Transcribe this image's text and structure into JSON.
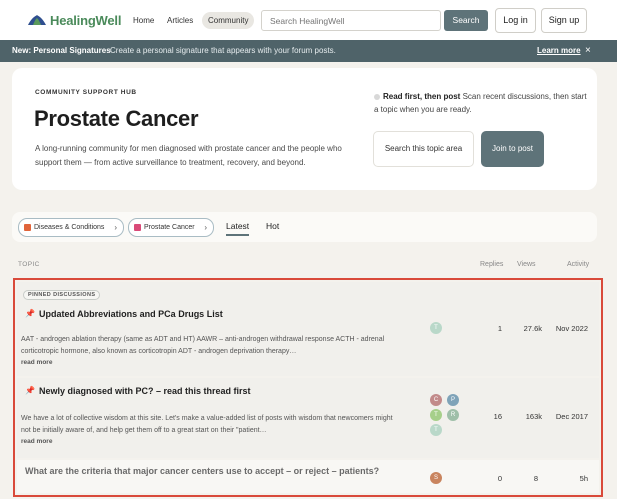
{
  "header": {
    "logo_text": "HealingWell",
    "nav": [
      "Home",
      "Articles",
      "Community"
    ],
    "search_placeholder": "Search HealingWell",
    "search_button": "Search",
    "login": "Log in",
    "signup": "Sign up"
  },
  "banner": {
    "title": "New: Personal Signatures",
    "text": "Create a personal signature that appears with your forum posts.",
    "link": "Learn more",
    "close": "×"
  },
  "hero": {
    "kicker": "COMMUNITY SUPPORT HUB",
    "title": "Prostate Cancer",
    "description": "A long-running community for men diagnosed with prostate cancer and the people who support them — from active surveillance to treatment, recovery, and beyond.",
    "tip_bold": "Read first, then post",
    "tip_text": "Scan recent discussions, then start a topic when you are ready.",
    "search_button": "Search this topic area",
    "join_button": "Join to post"
  },
  "filters": {
    "breadcrumbs": [
      {
        "label": "Diseases & Conditions",
        "color": "#e0643a"
      },
      {
        "label": "Prostate Cancer",
        "color": "#d94a78"
      }
    ],
    "tabs": [
      "Latest",
      "Hot"
    ]
  },
  "table_headers": {
    "topic": "TOPIC",
    "replies": "Replies",
    "views": "Views",
    "activity": "Activity"
  },
  "topics": [
    {
      "badge": "PINNED DISCUSSIONS",
      "title": "Updated Abbreviations and PCa Drugs List",
      "excerpt": "AAT - androgen ablation therapy (same as ADT and HT) AAWR – anti-androgen withdrawal response ACTH - adrenal corticotropic hormone, also known as corticotropin ADT - androgen deprivation therapy…",
      "read_more": "read more",
      "avatars": [
        {
          "letter": "T",
          "color": "#b9d8c9"
        }
      ],
      "replies": "1",
      "views": "27.6k",
      "activity": "Nov 2022"
    },
    {
      "title": "Newly diagnosed with PC? – read this thread first",
      "excerpt": "We have a lot of collective wisdom at this site. Let's make a value-added list of posts with wisdom that newcomers might not be initially aware of, and help get them off to a great start on their \"patient…",
      "read_more": "read more",
      "avatars": [
        {
          "letter": "C",
          "color": "#c28a8a"
        },
        {
          "letter": "P",
          "color": "#7fa3b8"
        },
        {
          "letter": "T",
          "color": "#a6cf8a"
        },
        {
          "letter": "R",
          "color": "#9fbfa9"
        },
        {
          "letter": "T",
          "color": "#b9d8c9"
        }
      ],
      "replies": "16",
      "views": "163k",
      "activity": "Dec 2017"
    },
    {
      "title": "What are the criteria that major cancer centers use to accept – or reject – patients?",
      "avatars": [
        {
          "letter": "S",
          "color": "#c9845e"
        }
      ],
      "replies": "0",
      "views": "8",
      "activity": "5h"
    }
  ],
  "icons": {
    "pin": "pin-icon",
    "chevron": "chevron-right-icon",
    "close": "close-icon",
    "logo": "leaf-logo-icon"
  }
}
